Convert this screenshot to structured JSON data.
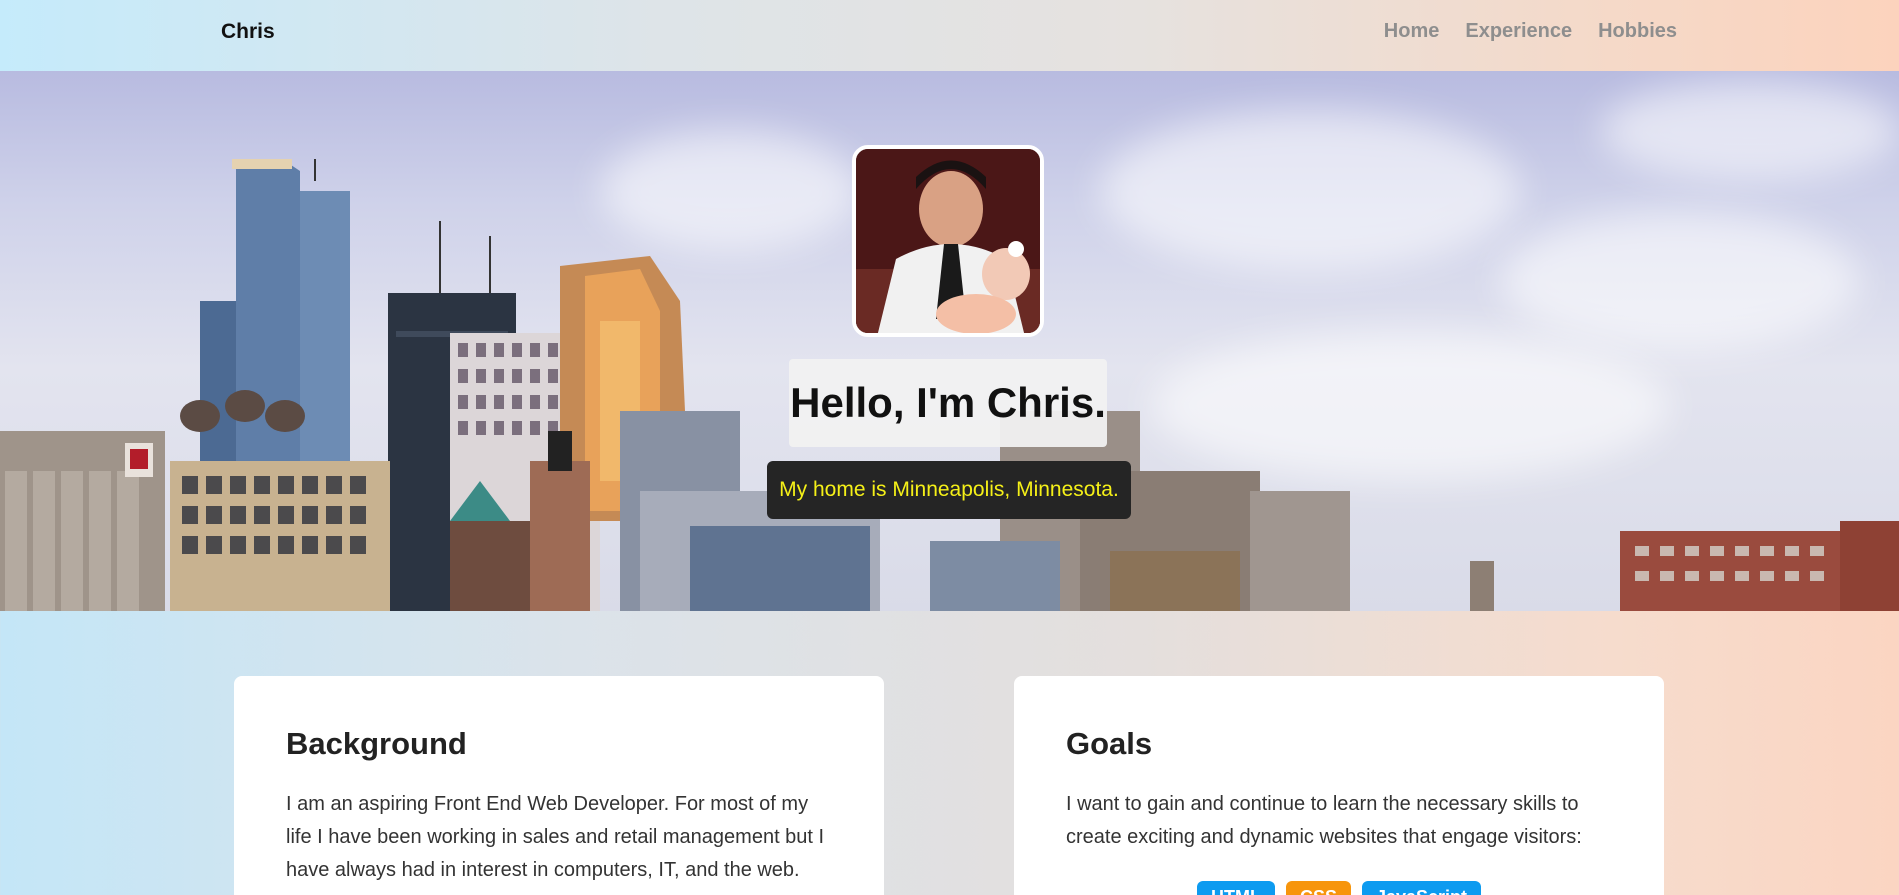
{
  "navbar": {
    "brand": "Chris",
    "links": [
      "Home",
      "Experience",
      "Hobbies"
    ]
  },
  "hero": {
    "title": "Hello, I'm Chris.",
    "subtitle": "My home is Minneapolis, Minnesota.",
    "subtitle_color": "#f5f018"
  },
  "background_card": {
    "heading": "Background",
    "text": "I am an aspiring Front End Web Developer. For most of my life I have been working in sales and retail management but I have always had in interest in computers, IT, and the web."
  },
  "goals_card": {
    "heading": "Goals",
    "text": "I want to gain and continue to learn the necessary skills to create exciting and dynamic websites that engage visitors:",
    "tags": [
      {
        "label": "HTML",
        "color": "#0d9bf0"
      },
      {
        "label": "CSS",
        "color": "#f7950c"
      },
      {
        "label": "JavaScript",
        "color": "#0d9bf0"
      }
    ]
  }
}
